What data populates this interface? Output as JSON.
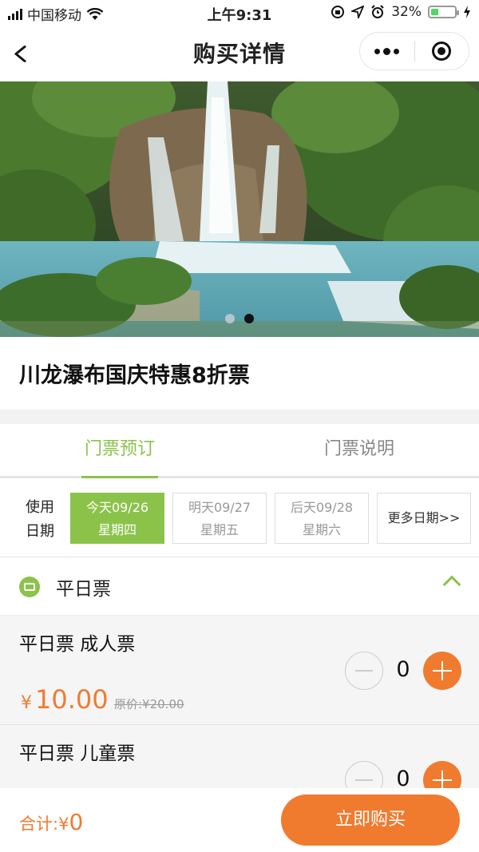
{
  "status_bar": {
    "carrier": "中国移动",
    "time": "上午9:31",
    "battery": "32%"
  },
  "nav": {
    "title": "购买详情"
  },
  "banner": {
    "slide_count": 2,
    "active_index": 1
  },
  "product": {
    "title": "川龙瀑布国庆特惠8折票"
  },
  "tabs": [
    {
      "label": "门票预订",
      "active": true
    },
    {
      "label": "门票说明",
      "active": false
    }
  ],
  "date_picker": {
    "label_line1": "使用",
    "label_line2": "日期",
    "dates": [
      {
        "date": "今天09/26",
        "weekday": "星期四",
        "selected": true
      },
      {
        "date": "明天09/27",
        "weekday": "星期五",
        "selected": false
      },
      {
        "date": "后天09/28",
        "weekday": "星期六",
        "selected": false
      }
    ],
    "more": "更多日期>>"
  },
  "ticket_section": {
    "title": "平日票",
    "items": [
      {
        "name": "平日票 成人票",
        "currency": "¥",
        "price": "10.00",
        "original": "原价:¥20.00",
        "quantity": "0"
      },
      {
        "name": "平日票 儿童票",
        "quantity": "0"
      }
    ]
  },
  "footer": {
    "total_label": "合计:",
    "currency": "¥",
    "total": "0",
    "buy_label": "立即购买"
  },
  "colors": {
    "accent_green": "#8bc34a",
    "accent_orange": "#f07b2f"
  }
}
